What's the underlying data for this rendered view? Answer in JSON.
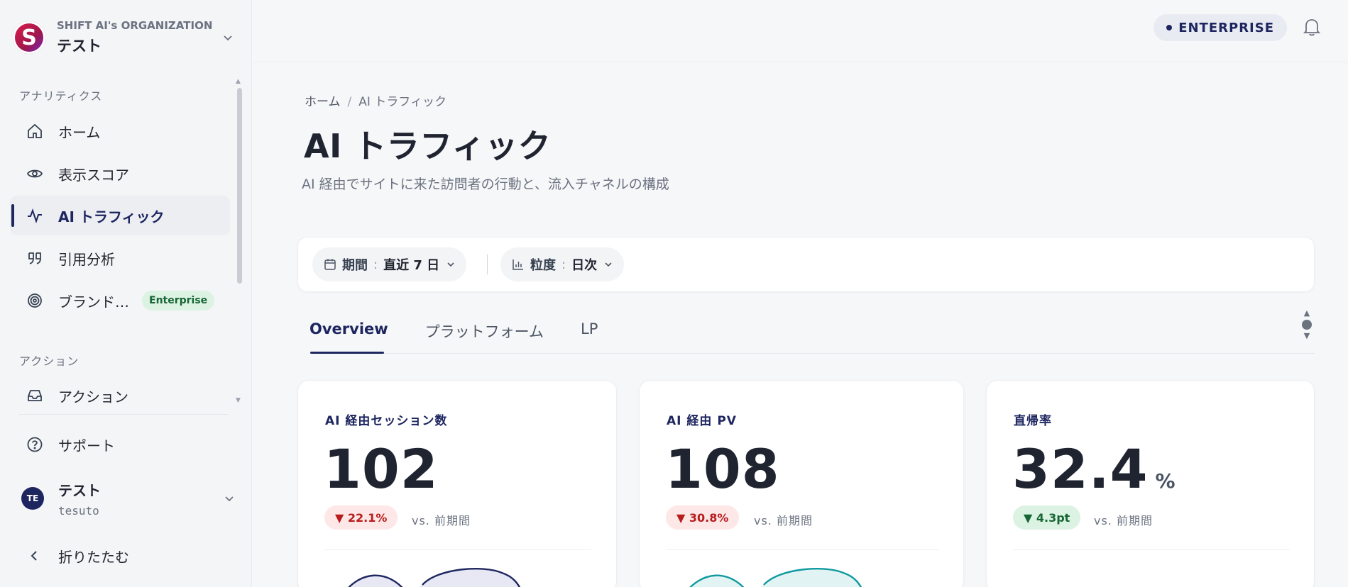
{
  "org": {
    "initial": "S",
    "label": "SHIFT AI's ORGANIZATION",
    "name": "テスト"
  },
  "sidebar": {
    "analytics_label": "アナリティクス",
    "items": [
      {
        "label": "ホーム",
        "icon": "home-icon"
      },
      {
        "label": "表示スコア",
        "icon": "eye-icon"
      },
      {
        "label": "AI トラフィック",
        "icon": "activity-icon",
        "active": true
      },
      {
        "label": "引用分析",
        "icon": "quote-icon"
      },
      {
        "label": "ブランド…",
        "icon": "target-icon",
        "badge": "Enterprise"
      }
    ],
    "action_label": "アクション",
    "action_items": [
      {
        "label": "アクション",
        "icon": "inbox-icon"
      }
    ],
    "support": "サポート",
    "user": {
      "initials": "TE",
      "name": "テスト",
      "id": "tesuto"
    },
    "collapse": "折りたたむ"
  },
  "topbar": {
    "plan": "ENTERPRISE"
  },
  "breadcrumb": {
    "home": "ホーム",
    "sep": "/",
    "current": "AI トラフィック"
  },
  "page": {
    "title": "AI トラフィック",
    "description": "AI 経由でサイトに来た訪問者の行動と、流入チャネルの構成"
  },
  "filters": {
    "period": {
      "key": "期間",
      "value": "直近 7 日"
    },
    "granularity": {
      "key": "粒度",
      "value": "日次"
    },
    "colon": ":"
  },
  "tabs": [
    "Overview",
    "プラットフォーム",
    "LP"
  ],
  "cards": [
    {
      "title": "AI 経由セッション数",
      "value": "102",
      "unit": "",
      "delta": "▼ 22.1%",
      "vs": "vs. 前期間"
    },
    {
      "title": "AI 経由 PV",
      "value": "108",
      "unit": "",
      "delta": "▼ 30.8%",
      "vs": "vs. 前期間"
    },
    {
      "title": "直帰率",
      "value": "32.4",
      "unit": "%",
      "delta": "▼ 4.3pt",
      "vs": "vs. 前期間"
    }
  ],
  "colors": {
    "accent": "#1e2660",
    "teal": "#0f9aa0",
    "negative": "#b91c1c",
    "positive": "#166534"
  }
}
